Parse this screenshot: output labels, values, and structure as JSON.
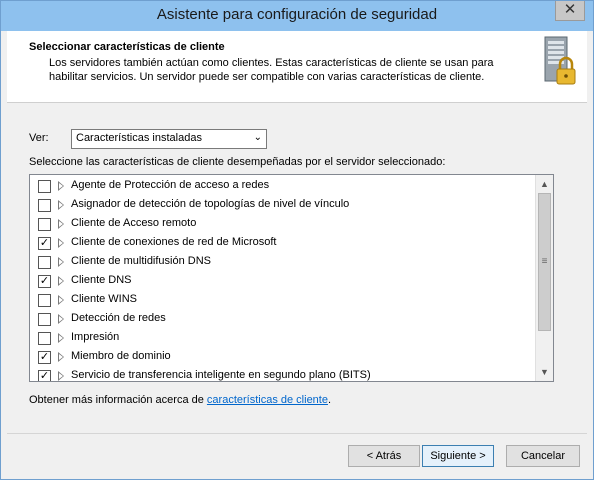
{
  "window": {
    "title": "Asistente para configuración de seguridad",
    "close_glyph": "✕"
  },
  "header": {
    "title": "Seleccionar características de cliente",
    "description": "Los servidores también actúan como clientes. Estas características de cliente se usan para habilitar servicios. Un servidor puede ser compatible con varias características de cliente.",
    "icon": "server-lock-icon"
  },
  "view": {
    "label": "Ver:",
    "selected": "Características instaladas"
  },
  "instructions": "Seleccione las características de cliente desempeñadas por el servidor seleccionado:",
  "features": [
    {
      "label": "Agente de Protección de acceso a redes",
      "checked": false
    },
    {
      "label": "Asignador de detección de topologías de nivel de vínculo",
      "checked": false
    },
    {
      "label": "Cliente de Acceso remoto",
      "checked": false
    },
    {
      "label": "Cliente de conexiones de red de Microsoft",
      "checked": true
    },
    {
      "label": "Cliente de multidifusión DNS",
      "checked": false
    },
    {
      "label": "Cliente DNS",
      "checked": true
    },
    {
      "label": "Cliente WINS",
      "checked": false
    },
    {
      "label": "Detección de redes",
      "checked": false
    },
    {
      "label": "Impresión",
      "checked": false
    },
    {
      "label": "Miembro de dominio",
      "checked": true
    },
    {
      "label": "Servicio de transferencia inteligente en segundo plano (BITS)",
      "checked": true
    }
  ],
  "more_info": {
    "prefix": "Obtener más información acerca de ",
    "link": "características de cliente",
    "suffix": "."
  },
  "buttons": {
    "back": "< Atrás",
    "next": "Siguiente >",
    "cancel": "Cancelar"
  }
}
